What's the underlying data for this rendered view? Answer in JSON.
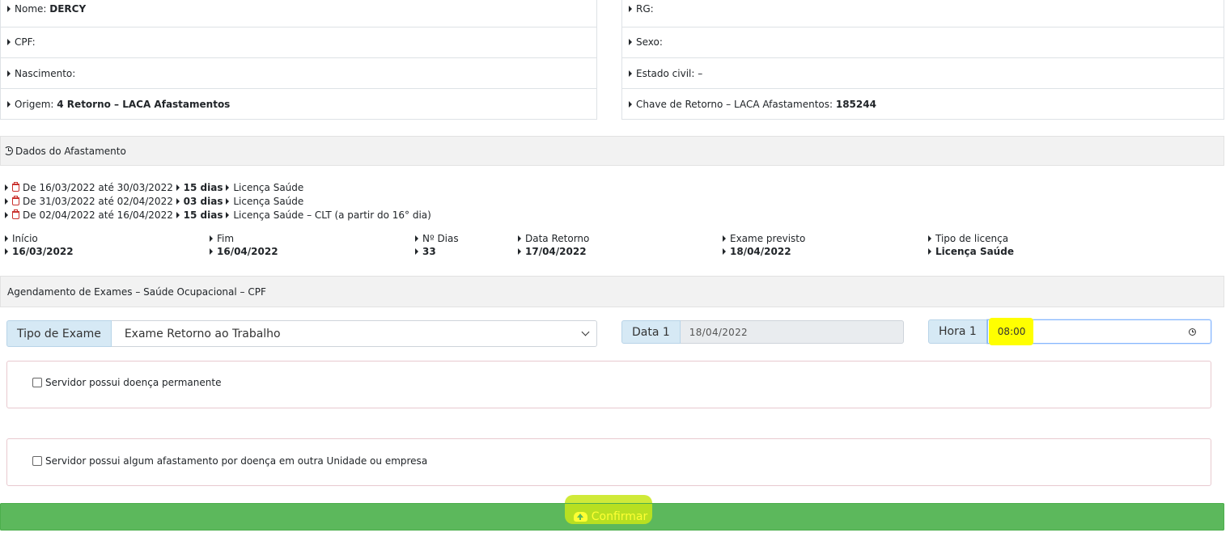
{
  "personal": {
    "left": [
      {
        "label": "Nome:",
        "value": "DERCY"
      },
      {
        "label": "CPF:",
        "value": ""
      },
      {
        "label": "Nascimento:",
        "value": ""
      },
      {
        "label": "Origem:",
        "value": "4 Retorno – LACA Afastamentos"
      }
    ],
    "right": [
      {
        "label": "RG:",
        "value": ""
      },
      {
        "label": "Sexo:",
        "value": ""
      },
      {
        "label": "Estado civil: –",
        "value": ""
      },
      {
        "label": "Chave de Retorno – LACA Afastamentos:",
        "value": "185244"
      }
    ]
  },
  "afastamento": {
    "title": "Dados do Afastamento",
    "items": [
      {
        "period": "De 16/03/2022 até 30/03/2022",
        "days": "15 dias",
        "type": "Licença Saúde"
      },
      {
        "period": "De 31/03/2022 até 02/04/2022",
        "days": "03 dias",
        "type": "Licença Saúde"
      },
      {
        "period": "De 02/04/2022 até 16/04/2022",
        "days": "15 dias",
        "type": "Licença Saúde – CLT (a partir do 16° dia)"
      }
    ],
    "stats": [
      {
        "label": "Início",
        "value": "16/03/2022"
      },
      {
        "label": "Fim",
        "value": "16/04/2022"
      },
      {
        "label": "Nº Dias",
        "value": "33"
      },
      {
        "label": "Data Retorno",
        "value": "17/04/2022"
      },
      {
        "label": "Exame previsto",
        "value": "18/04/2022"
      },
      {
        "label": "Tipo de licença",
        "value": "Licença Saúde"
      }
    ]
  },
  "agendamento": {
    "title": "Agendamento de Exames – Saúde Ocupacional – CPF",
    "tipo_label": "Tipo de Exame",
    "tipo_value": "Exame Retorno ao Trabalho",
    "data_label": "Data 1",
    "data_value": "18/04/2022",
    "hora_label": "Hora 1",
    "hora_value": "08:00",
    "check1": "Servidor possui doença permanente",
    "check2": "Servidor possui algum afastamento por doença em outra Unidade ou empresa",
    "confirm": "Confirmar"
  },
  "colors": {
    "confirm_bg": "#5cb85c",
    "highlight": "#ffff00",
    "addon_bg": "#d6e9f5"
  }
}
